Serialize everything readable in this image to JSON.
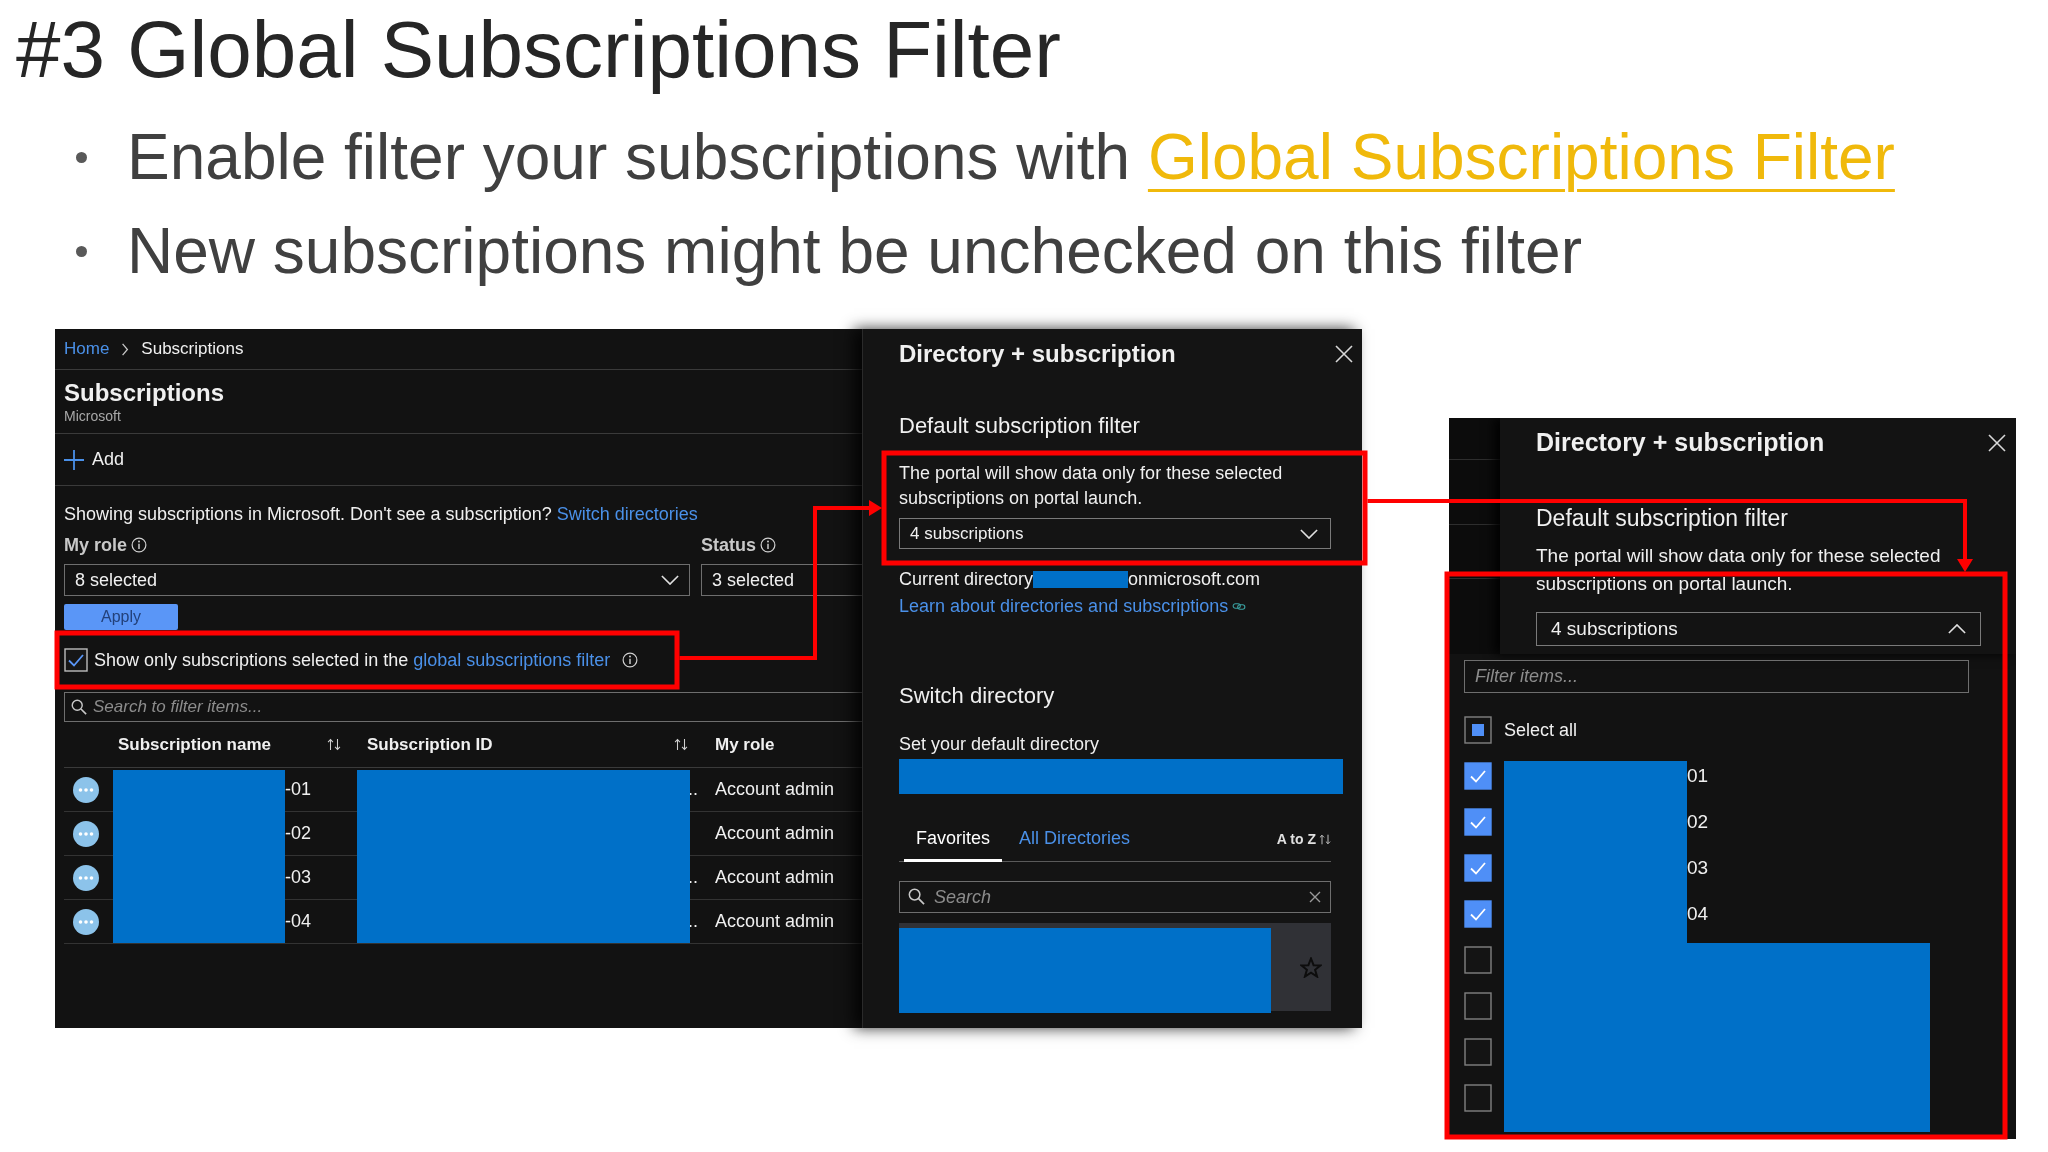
{
  "slide": {
    "title": "#3 Global Subscriptions Filter",
    "bullets": [
      {
        "text": "Enable filter your subscriptions with ",
        "link": "Global Subscriptions Filter"
      },
      {
        "text": "New subscriptions might be unchecked on this filter"
      }
    ]
  },
  "subscriptions_blade": {
    "breadcrumb": [
      "Home",
      "Subscriptions"
    ],
    "title": "Subscriptions",
    "subtitle": "Microsoft",
    "add_button": "Add",
    "info": {
      "text": "Showing subscriptions in Microsoft. Don't see a subscription? ",
      "link": "Switch directories"
    },
    "filters": [
      {
        "label": "My role",
        "value": "8 selected"
      },
      {
        "label": "Status",
        "value": "3 selected"
      }
    ],
    "apply_button": "Apply",
    "global_filter_checkbox": {
      "label": "Show only subscriptions selected in the ",
      "link": "global subscriptions filter",
      "checked": true
    },
    "search": {
      "placeholder": "Search to filter items..."
    },
    "table": {
      "columns": [
        "Subscription name",
        "Subscription ID",
        "My role"
      ],
      "rows": [
        {
          "name_end": "-01",
          "id_end": "..",
          "role": "Account admin"
        },
        {
          "name_end": "-02",
          "role": "Account admin"
        },
        {
          "name_end": "-03",
          "id_end": "..",
          "role": "Account admin"
        },
        {
          "name_end": "-04",
          "id_end": "..",
          "role": "Account admin"
        }
      ]
    }
  },
  "directory_panel": {
    "title": "Directory + subscription",
    "filter_heading": "Default subscription filter",
    "filter_description": "The portal will show data only for these selected subscriptions on portal launch.",
    "subscriptions_dropdown": {
      "value": "4 subscriptions",
      "expanded": false
    },
    "current_directory": {
      "label": "Current directory",
      "domain_end": "onmicrosoft.com"
    },
    "learn_link": "Learn about directories and subscriptions",
    "switch_heading": "Switch directory",
    "default_directory_label": "Set your default directory",
    "tabs": [
      {
        "label": "Favorites",
        "selected": true
      },
      {
        "label": "All Directories",
        "selected": false
      }
    ],
    "sort": "A to Z",
    "search": {
      "placeholder": "Search"
    }
  },
  "directory_panel_expanded": {
    "title": "Directory + subscription",
    "filter_heading": "Default subscription filter",
    "filter_description": "The portal will show data only for these selected subscriptions on portal launch.",
    "subscriptions_dropdown": {
      "value": "4 subscriptions",
      "expanded": true
    },
    "filter": {
      "placeholder": "Filter items..."
    },
    "select_all": {
      "label": "Select all",
      "checked": false,
      "indeterminate": true
    },
    "items": [
      {
        "label_end": "01",
        "checked": true
      },
      {
        "label_end": "02",
        "checked": true
      },
      {
        "label_end": "03",
        "checked": true
      },
      {
        "label_end": "04",
        "checked": true
      },
      {
        "checked": false
      },
      {
        "checked": false
      },
      {
        "checked": false
      },
      {
        "checked": false
      }
    ]
  }
}
